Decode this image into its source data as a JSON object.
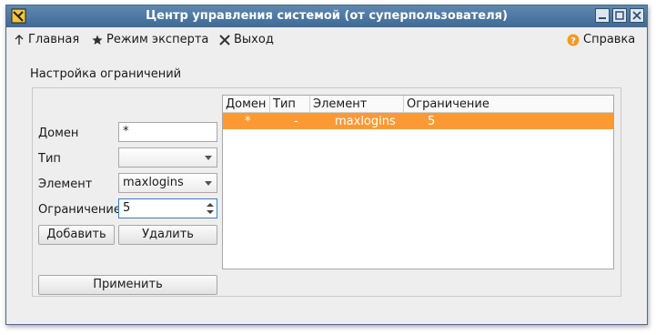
{
  "window": {
    "title": "Центр управления системой (от суперпользователя)",
    "colors": {
      "titlebar": "#4a76a0",
      "selection": "#fb9a35"
    }
  },
  "toolbar": {
    "home_label": "Главная",
    "expert_label": "Режим эксперта",
    "exit_label": "Выход",
    "help_label": "Справка"
  },
  "section": {
    "title": "Настройка ограничений"
  },
  "form": {
    "domain_label": "Домен",
    "domain_value": "*",
    "type_label": "Тип",
    "type_value": "",
    "element_label": "Элемент",
    "element_value": "maxlogins",
    "limit_label": "Ограничение",
    "limit_value": "5",
    "add_label": "Добавить",
    "delete_label": "Удалить",
    "apply_label": "Применить"
  },
  "table": {
    "columns": [
      "Домен",
      "Тип",
      "Элемент",
      "Ограничение"
    ],
    "rows": [
      {
        "domain": "*",
        "type": "-",
        "element": "maxlogins",
        "limit": "5"
      }
    ]
  },
  "icons": {
    "app": "control-center-icon",
    "home": "up-arrow-icon",
    "expert": "star-icon",
    "exit": "exit-x-icon",
    "help": "help-icon"
  }
}
